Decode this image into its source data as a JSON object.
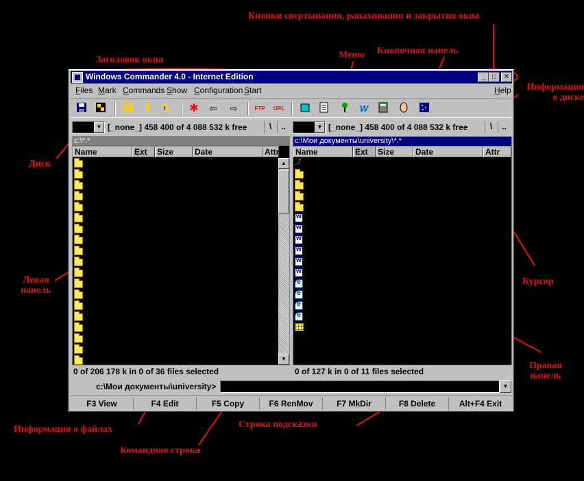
{
  "annotations": {
    "window_buttons": "Кнопки свертывания, рапахивания и закрытия окна",
    "title": "Заголовок окна",
    "menu": "Меню",
    "toolbar": "Кнопочная панель",
    "disk_info": "Информация\nо диске",
    "disk": "Диск",
    "left_panel": "Левая\nпанель",
    "cursor": "Курсор",
    "right_panel": "Правая\nпанель",
    "file_info": "Информация о файлах",
    "hint_line": "Строка подсказки",
    "command_line": "Командная строка"
  },
  "window": {
    "title": "Windows Commander 4.0 - Internet Edition"
  },
  "menu": {
    "items": [
      "Files",
      "Mark",
      "Commands",
      "Show",
      "Configuration",
      "Start"
    ],
    "help": "Help"
  },
  "toolbar": {
    "icons": [
      "save-icon",
      "pack-icon",
      "grid-icon",
      "sort-icon",
      "tree-icon",
      "star-icon",
      "back-arrow-icon",
      "forward-arrow-icon",
      "ftp-icon",
      "url-icon",
      "notepad-icon",
      "doc-icon",
      "paint-icon",
      "word-icon",
      "calc-icon",
      "face-icon",
      "screen-icon"
    ],
    "labels": {
      "ftp": "FTP",
      "url": "URL",
      "word": "W",
      "back": "⇦",
      "forward": "⇨",
      "star": "✱"
    }
  },
  "left_drive": {
    "info": "[_none_]  458 400 of 4 088 532 k free",
    "root_btn": "\\",
    "up_btn": ".."
  },
  "right_drive": {
    "info": "[_none_]  458 400 of 4 088 532 k free",
    "root_btn": "\\",
    "up_btn": ".."
  },
  "left_panel": {
    "path": "c:\\*.*",
    "columns": [
      "Name",
      "Ext",
      "Size",
      "Date",
      "Attr"
    ],
    "status": "0 of 206 178 k in 0 of 36 files selected"
  },
  "right_panel": {
    "path": "c:\\Мои документы\\university\\*.*",
    "columns": [
      "Name",
      "Ext",
      "Size",
      "Date",
      "Attr"
    ],
    "status": "0 of 127 k in 0 of 11 files selected"
  },
  "command": {
    "label": "c:\\Мои документы\\university>"
  },
  "fkeys": [
    "F3 View",
    "F4 Edit",
    "F5 Copy",
    "F6 RenMov",
    "F7 MkDir",
    "F8 Delete",
    "Alt+F4 Exit"
  ],
  "colors": {
    "annotation": "#e01010",
    "titlebar": "#000080",
    "chrome": "#c0c0c0"
  }
}
